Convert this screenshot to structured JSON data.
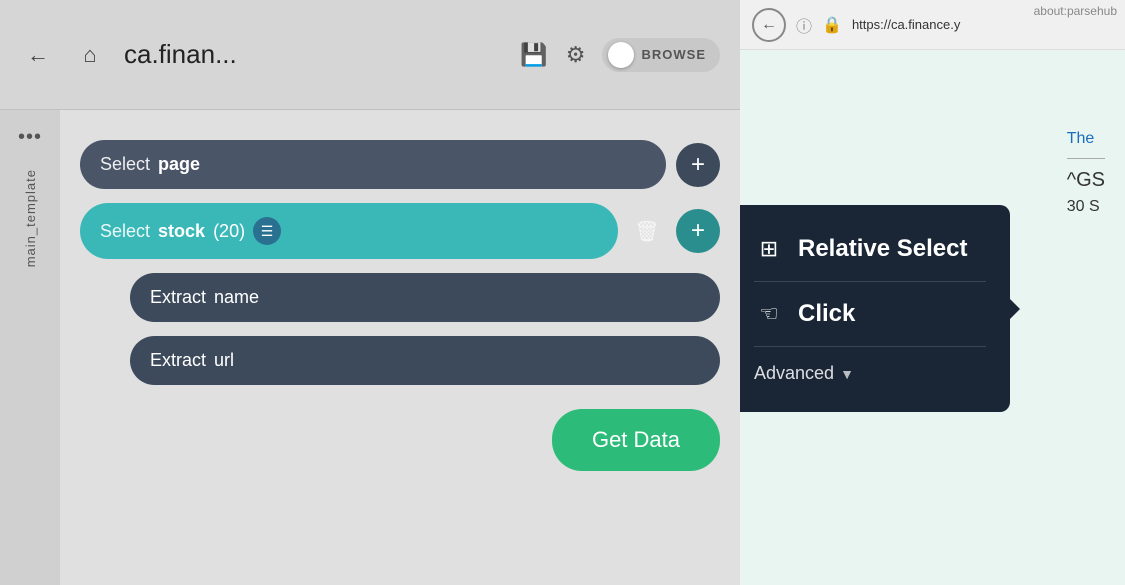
{
  "topbar": {
    "back_icon": "←",
    "home_icon": "⌂",
    "title": "ca.finan...",
    "save_icon": "💾",
    "settings_icon": "⚙",
    "browse_label": "BROWSE"
  },
  "sidebar": {
    "dots": "•••",
    "label": "main_template"
  },
  "selectors": [
    {
      "keyword": "Select",
      "value": "page",
      "type": "page"
    },
    {
      "keyword": "Select",
      "value": "stock",
      "count": "(20)",
      "type": "stock"
    }
  ],
  "extracts": [
    {
      "keyword": "Extract",
      "value": "name"
    },
    {
      "keyword": "Extract",
      "value": "url"
    }
  ],
  "get_data_btn": "Get Data",
  "popup": {
    "relative_select_label": "Relative Select",
    "click_label": "Click",
    "advanced_label": "Advanced",
    "advanced_arrow": "▼"
  },
  "browser": {
    "address_bar_title": "about:parsehub",
    "back_icon": "←",
    "url": "https://ca.finance.y",
    "text1": "The",
    "text2": "^GS",
    "text3": "30 S"
  }
}
